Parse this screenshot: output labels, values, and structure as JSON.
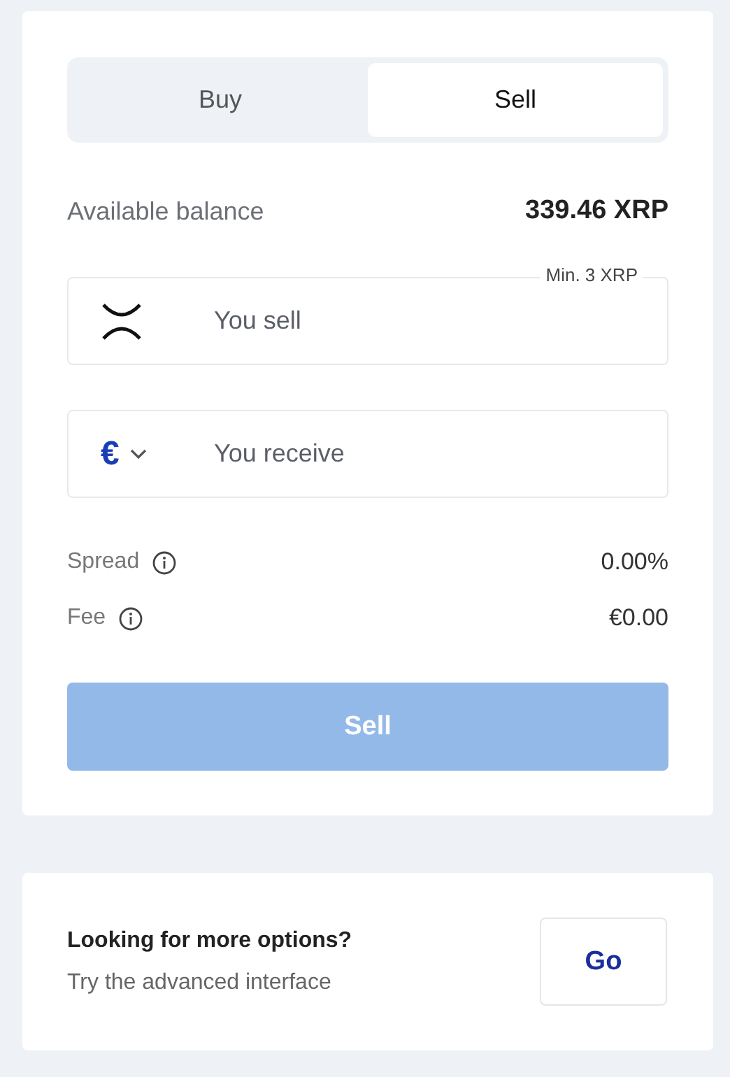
{
  "tabs": [
    {
      "label": "Buy",
      "selected": false
    },
    {
      "label": "Sell",
      "selected": true
    }
  ],
  "balance": {
    "label": "Available balance",
    "value": "339.46 XRP"
  },
  "sell_field": {
    "placeholder": "You sell",
    "hint": "Min. 3 XRP"
  },
  "receive_field": {
    "currency": "€",
    "placeholder": "You receive"
  },
  "details": [
    {
      "label": "Spread",
      "value": "0.00%"
    },
    {
      "label": "Fee",
      "value": "€0.00"
    }
  ],
  "submit": {
    "label": "Sell",
    "disabled": true
  },
  "promo": {
    "title": "Looking for more options?",
    "subtitle": "Try the advanced interface",
    "button": "Go"
  }
}
